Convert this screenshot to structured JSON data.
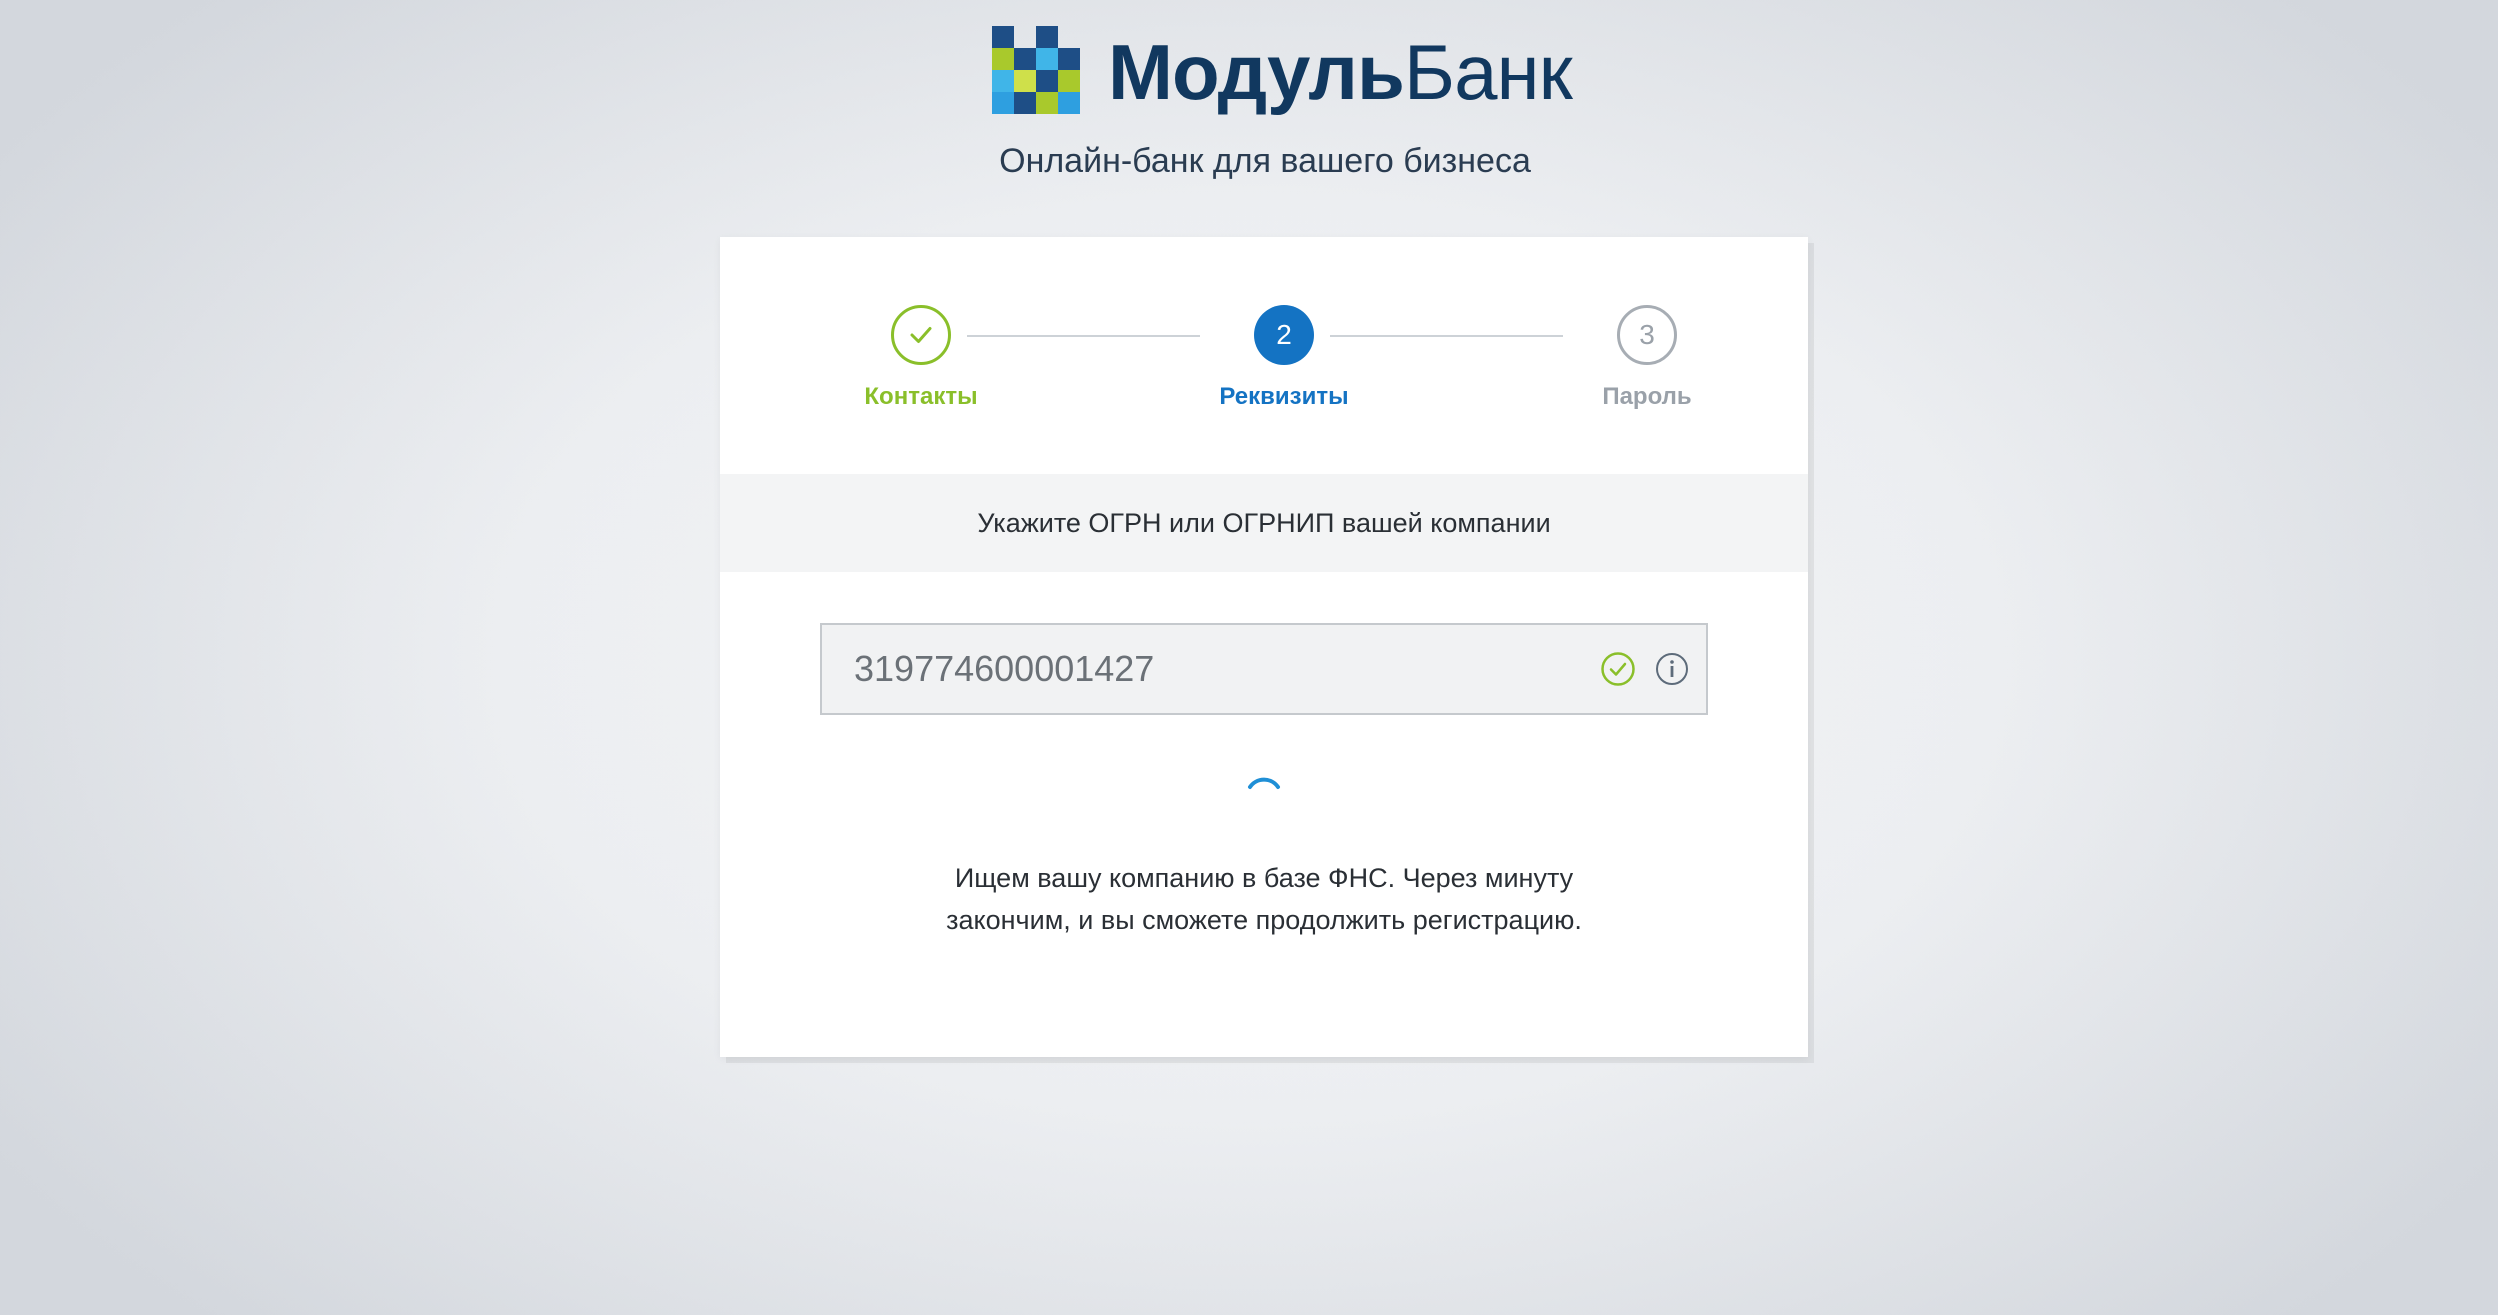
{
  "header": {
    "logo_bold": "Модуль",
    "logo_light": "Банк",
    "tagline": "Онлайн-банк для вашего бизнеса"
  },
  "colors": {
    "brand_dark": "#11385f",
    "accent_blue": "#1473c3",
    "success_green": "#8abf2a",
    "inactive_gray": "#9aa1a9"
  },
  "stepper": {
    "steps": [
      {
        "number": "",
        "label": "Контакты",
        "state": "completed",
        "icon": "check-icon"
      },
      {
        "number": "2",
        "label": "Реквизиты",
        "state": "active"
      },
      {
        "number": "3",
        "label": "Пароль",
        "state": "inactive"
      }
    ]
  },
  "form": {
    "instruction": "Укажите ОГРН или ОГРНИП вашей компании",
    "ogrn_value": "319774600001427",
    "valid_icon": "check-circle-icon",
    "info_icon": "info-icon"
  },
  "status": {
    "line1": "Ищем вашу компанию в базе ФНС. Через минуту",
    "line2": "закончим, и вы сможете продолжить регистрацию."
  }
}
